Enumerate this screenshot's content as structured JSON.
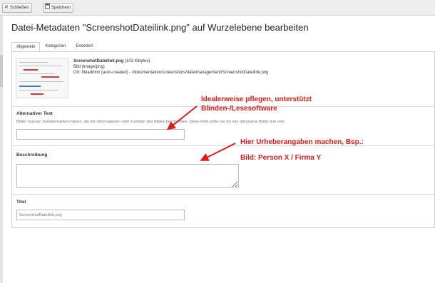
{
  "toolbar": {
    "close_label": "Schließen",
    "save_label": "Speichern",
    "close_icon": "close-icon",
    "save_icon": "save-icon"
  },
  "page": {
    "title": "Datei-Metadaten \"ScreenshotDateilink.png\" auf Wurzelebene bearbeiten"
  },
  "tabs": [
    {
      "label": "Allgemein",
      "active": true
    },
    {
      "label": "Kategorien",
      "active": false
    },
    {
      "label": "Erweitert",
      "active": false
    }
  ],
  "file": {
    "name": "ScreenshotDateilink.png",
    "size": "(103 Kibytes)",
    "type": "Bild (image/png)",
    "location": "Ort: fileadmin/ (auto-created) - /dokumentation/screenshots/dateimanagement/ScreenshotDateilink.png"
  },
  "fields": {
    "alt": {
      "label": "Alternativer Text",
      "help": "Bilder müssen Textalternativen haben, die die Informationen oder Funktion des Bildes beschreiben. Diese Feld sollte nur für rein dekorative Bilder leer sein.",
      "value": ""
    },
    "description": {
      "label": "Beschreibung",
      "value": ""
    },
    "title": {
      "label": "Titel",
      "placeholder": "ScreenshotDateilink.png"
    }
  },
  "annotations": {
    "alt_line1": "Idealerweise pflegen, unterstützt",
    "alt_line2": "Blinden-/Lesesoftware",
    "desc_line1": "Hier Urheberangaben machen, Bsp.:",
    "desc_line2": "Bild: Person X / Firma Y",
    "color": "#e51b1b"
  }
}
